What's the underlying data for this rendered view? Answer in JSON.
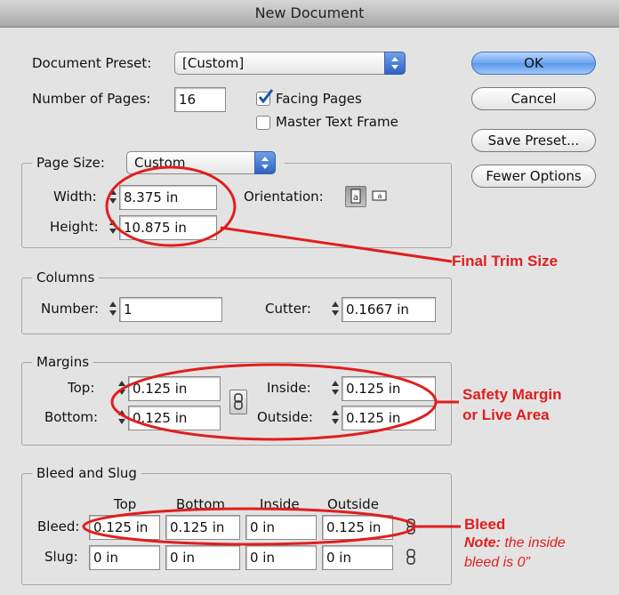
{
  "window": {
    "title": "New Document"
  },
  "document": {
    "preset_label": "Document Preset:",
    "preset_value": "[Custom]",
    "pages_label": "Number of Pages:",
    "pages_value": "16",
    "facing_pages_label": "Facing Pages",
    "facing_pages_checked": true,
    "master_text_frame_label": "Master Text Frame",
    "master_text_frame_checked": false
  },
  "buttons": {
    "ok": "OK",
    "cancel": "Cancel",
    "save_preset": "Save Preset...",
    "fewer_options": "Fewer Options"
  },
  "page_size": {
    "label": "Page Size:",
    "value": "Custom",
    "width_label": "Width:",
    "width_value": "8.375 in",
    "height_label": "Height:",
    "height_value": "10.875 in",
    "orientation_label": "Orientation:"
  },
  "columns": {
    "legend": "Columns",
    "number_label": "Number:",
    "number_value": "1",
    "gutter_label": "Cutter:",
    "gutter_value": "0.1667 in"
  },
  "margins": {
    "legend": "Margins",
    "top_label": "Top:",
    "top_value": "0.125 in",
    "bottom_label": "Bottom:",
    "bottom_value": "0.125 in",
    "inside_label": "Inside:",
    "inside_value": "0.125 in",
    "outside_label": "Outside:",
    "outside_value": "0.125 in"
  },
  "bleed_slug": {
    "legend": "Bleed and Slug",
    "headers": [
      "Top",
      "Bottom",
      "Inside",
      "Outside"
    ],
    "bleed_label": "Bleed:",
    "bleed_values": [
      "0.125 in",
      "0.125 in",
      "0 in",
      "0.125 in"
    ],
    "slug_label": "Slug:",
    "slug_values": [
      "0 in",
      "0 in",
      "0 in",
      "0 in"
    ]
  },
  "annotations": {
    "trim": "Final Trim Size",
    "safety_line1": "Safety Margin",
    "safety_line2": "or Live Area",
    "bleed": "Bleed",
    "note_bold": "Note:",
    "note_rest": " the inside",
    "note_line2": "bleed is 0”"
  },
  "colors": {
    "annotation_red": "#e01e1e",
    "ok_blue": "#6da5ef",
    "popup_blue": "#2f62c4"
  }
}
